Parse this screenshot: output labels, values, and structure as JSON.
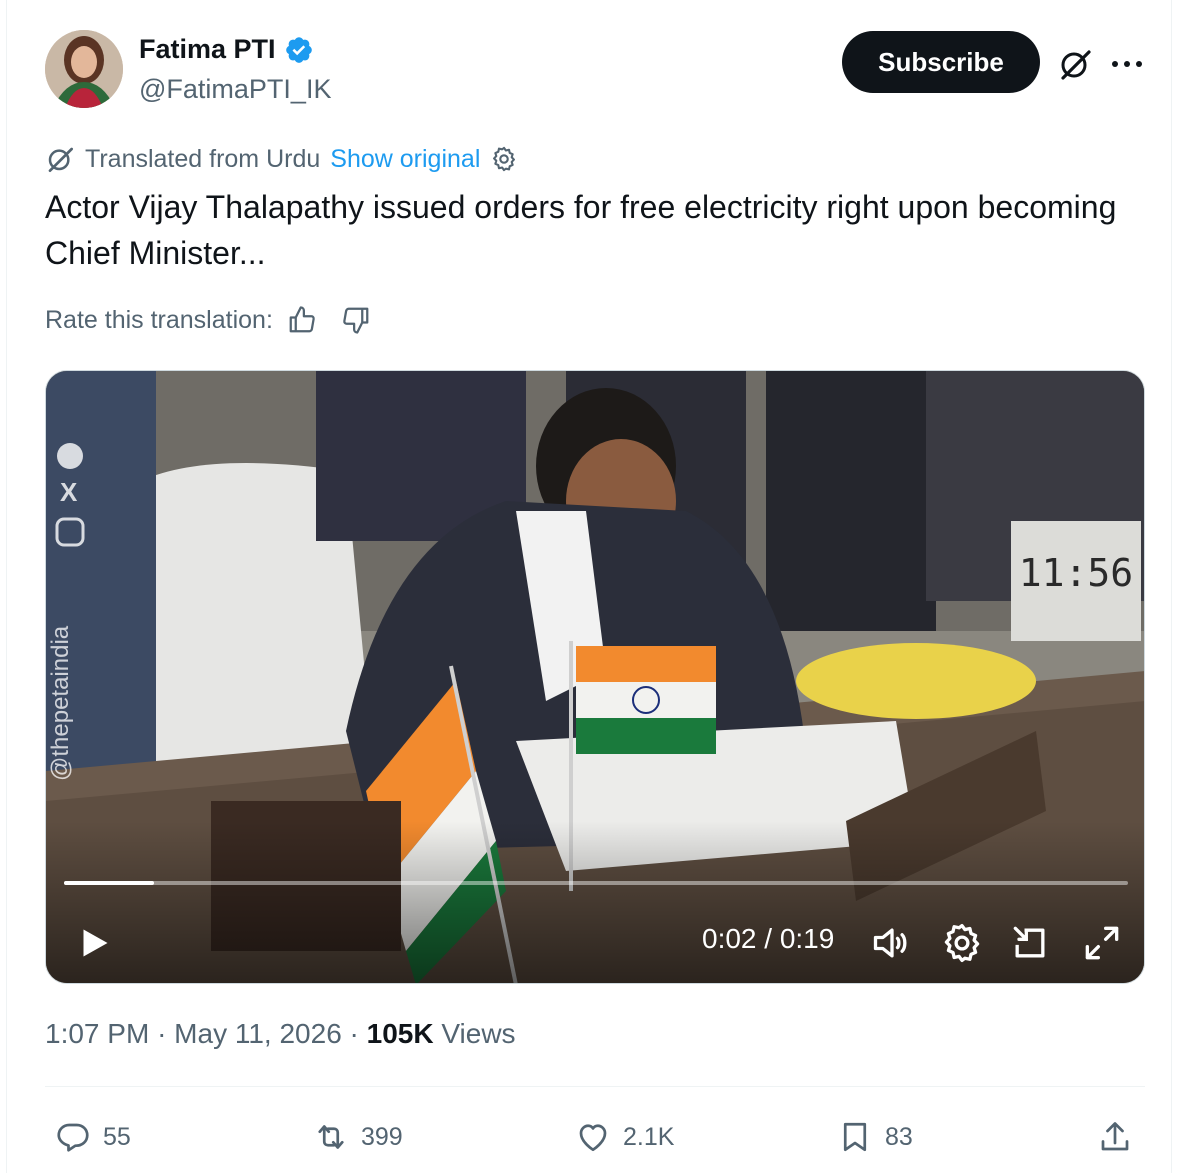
{
  "author": {
    "name": "Fatima PTI",
    "handle": "@FatimaPTI_IK",
    "subscribe_label": "Subscribe"
  },
  "translation": {
    "label": "Translated from Urdu",
    "show_original": "Show original",
    "rate_label": "Rate this translation:"
  },
  "tweet": {
    "text": "Actor Vijay Thalapathy issued orders for free electricity right upon becoming Chief Minister..."
  },
  "video": {
    "current_time": "0:02",
    "duration": "0:19",
    "time_display": "0:02 / 0:19",
    "progress": 0.085,
    "watermark": "@thepetaindia",
    "clock_text": "11:56"
  },
  "meta": {
    "time": "1:07 PM",
    "separator": "·",
    "date": "May 11, 2026",
    "views_count": "105K",
    "views_label": "Views"
  },
  "actions": {
    "replies": "55",
    "reposts": "399",
    "likes": "2.1K",
    "bookmarks": "83"
  },
  "colors": {
    "accent": "#1d9bf0",
    "text_primary": "#0f1419",
    "text_secondary": "#536471"
  }
}
